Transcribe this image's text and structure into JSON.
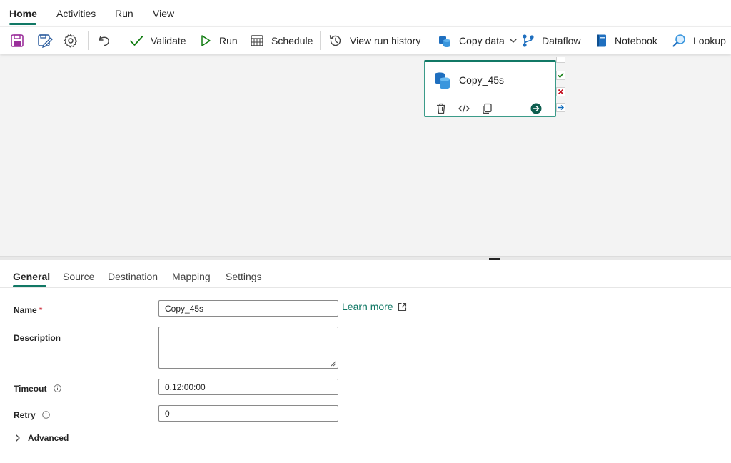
{
  "menu": {
    "tabs": [
      {
        "label": "Home",
        "active": true
      },
      {
        "label": "Activities"
      },
      {
        "label": "Run"
      },
      {
        "label": "View"
      }
    ]
  },
  "toolbar": {
    "icons": [
      "save-icon",
      "save-as-icon",
      "settings-icon",
      "undo-icon"
    ],
    "validate_label": "Validate",
    "run_label": "Run",
    "schedule_label": "Schedule",
    "view_run_history_label": "View run history",
    "copy_data_label": "Copy data",
    "dataflow_label": "Dataflow",
    "notebook_label": "Notebook",
    "lookup_label": "Lookup"
  },
  "activity": {
    "name": "Copy_45s",
    "status_colors": {
      "success": "#107c10",
      "fail": "#c50f1f",
      "completion": "#0f6cbd"
    }
  },
  "panel": {
    "tabs": [
      {
        "label": "General",
        "active": true
      },
      {
        "label": "Source"
      },
      {
        "label": "Destination"
      },
      {
        "label": "Mapping"
      },
      {
        "label": "Settings"
      }
    ]
  },
  "form": {
    "name_label": "Name",
    "required_mark": "*",
    "name_value": "Copy_45s",
    "learn_more": "Learn more",
    "description_label": "Description",
    "description_value": "",
    "timeout_label": "Timeout",
    "timeout_value": "0.12:00:00",
    "retry_label": "Retry",
    "retry_value": "0",
    "advanced_label": "Advanced"
  },
  "colors": {
    "accent": "#117865",
    "canvas_bg": "#f3f3f3"
  }
}
